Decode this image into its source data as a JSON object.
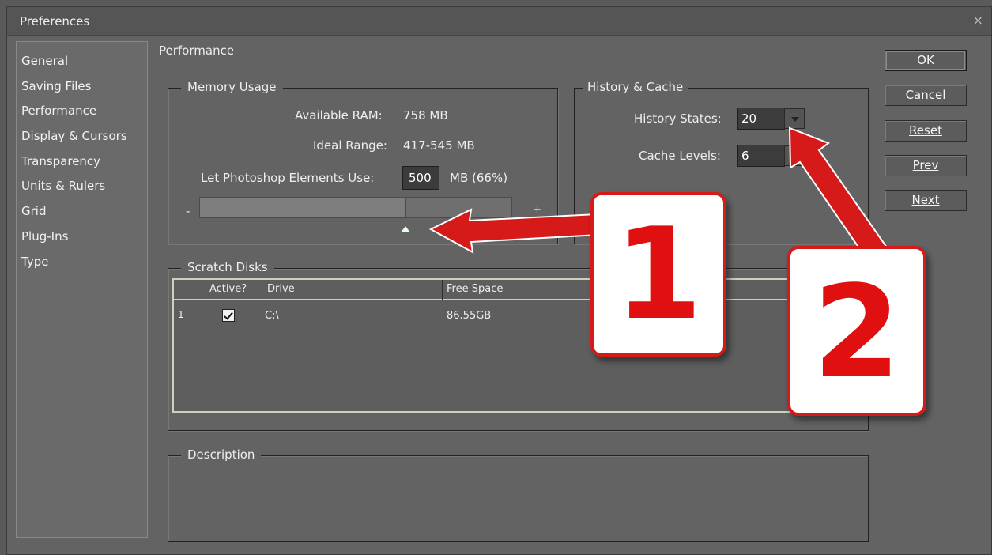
{
  "window": {
    "title": "Preferences",
    "close_glyph": "×"
  },
  "sidebar": {
    "items": [
      {
        "label": "General"
      },
      {
        "label": "Saving Files"
      },
      {
        "label": "Performance"
      },
      {
        "label": "Display & Cursors"
      },
      {
        "label": "Transparency"
      },
      {
        "label": "Units & Rulers"
      },
      {
        "label": "Grid"
      },
      {
        "label": "Plug-Ins"
      },
      {
        "label": "Type"
      }
    ],
    "selected": "Performance"
  },
  "main": {
    "section_title": "Performance",
    "memory": {
      "legend": "Memory Usage",
      "available_label": "Available RAM:",
      "available_value": "758 MB",
      "ideal_label": "Ideal Range:",
      "ideal_value": "417-545 MB",
      "use_label": "Let Photoshop Elements Use:",
      "use_value": "500",
      "use_suffix": "MB (66%)",
      "slider_minus": "-",
      "slider_plus": "+",
      "slider_fraction": 0.66
    },
    "history": {
      "legend": "History & Cache",
      "states_label": "History States:",
      "states_value": "20",
      "cache_label": "Cache Levels:",
      "cache_value": "6"
    },
    "scratch": {
      "legend": "Scratch Disks",
      "columns": [
        "Active?",
        "Drive",
        "Free Space"
      ],
      "rows": [
        {
          "index": "1",
          "active": true,
          "drive": "C:\\",
          "free": "86.55GB"
        }
      ]
    },
    "description": {
      "legend": "Description"
    }
  },
  "buttons": {
    "ok": "OK",
    "cancel": "Cancel",
    "reset": "Reset",
    "prev": "Prev",
    "next": "Next"
  },
  "callouts": {
    "one": "1",
    "two": "2",
    "color": "#d61a1a"
  }
}
